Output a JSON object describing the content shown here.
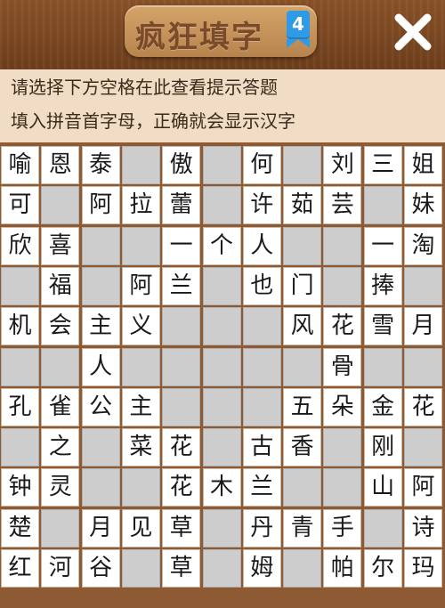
{
  "header": {
    "logo_text": "疯狂填字",
    "level_badge": "4",
    "close_icon": "close-icon"
  },
  "hint": {
    "line1": "请选择下方空格在此查看提示答题",
    "line2": "填入拼音首字母，正确就会显示汉字"
  },
  "colors": {
    "wood_dark": "#6e3e1c",
    "wood_light": "#8a5228",
    "hint_bg": "#f1ddc6",
    "cell_filled": "#ffffff",
    "cell_empty": "#cdcdcd",
    "badge_blue": "#2f9be6"
  },
  "board": {
    "rows": [
      [
        "喻",
        "恩",
        "泰",
        "",
        "傲",
        "",
        "何",
        "",
        "刘",
        "三",
        "姐"
      ],
      [
        "可",
        "",
        "阿",
        "拉",
        "蕾",
        "",
        "许",
        "茹",
        "芸",
        "",
        "妹"
      ],
      [
        "欣",
        "喜",
        "",
        "",
        "一",
        "个",
        "人",
        "",
        "",
        "一",
        "淘"
      ],
      [
        "",
        "福",
        "",
        "阿",
        "兰",
        "",
        "也",
        "门",
        "",
        "捧",
        ""
      ],
      [
        "机",
        "会",
        "主",
        "义",
        "",
        "",
        "",
        "风",
        "花",
        "雪",
        "月"
      ],
      [
        "",
        "",
        "人",
        "",
        "",
        "",
        "",
        "",
        "骨",
        "",
        ""
      ],
      [
        "孔",
        "雀",
        "公",
        "主",
        "",
        "",
        "",
        "五",
        "朵",
        "金",
        "花"
      ],
      [
        "",
        "之",
        "",
        "菜",
        "花",
        "",
        "古",
        "香",
        "",
        "刚",
        ""
      ],
      [
        "钟",
        "灵",
        "",
        "",
        "花",
        "木",
        "兰",
        "",
        "",
        "山",
        "阿"
      ],
      [
        "楚",
        "",
        "月",
        "见",
        "草",
        "",
        "丹",
        "青",
        "手",
        "",
        "诗"
      ],
      [
        "红",
        "河",
        "谷",
        "",
        "草",
        "",
        "姆",
        "",
        "帕",
        "尔",
        "玛"
      ]
    ]
  }
}
